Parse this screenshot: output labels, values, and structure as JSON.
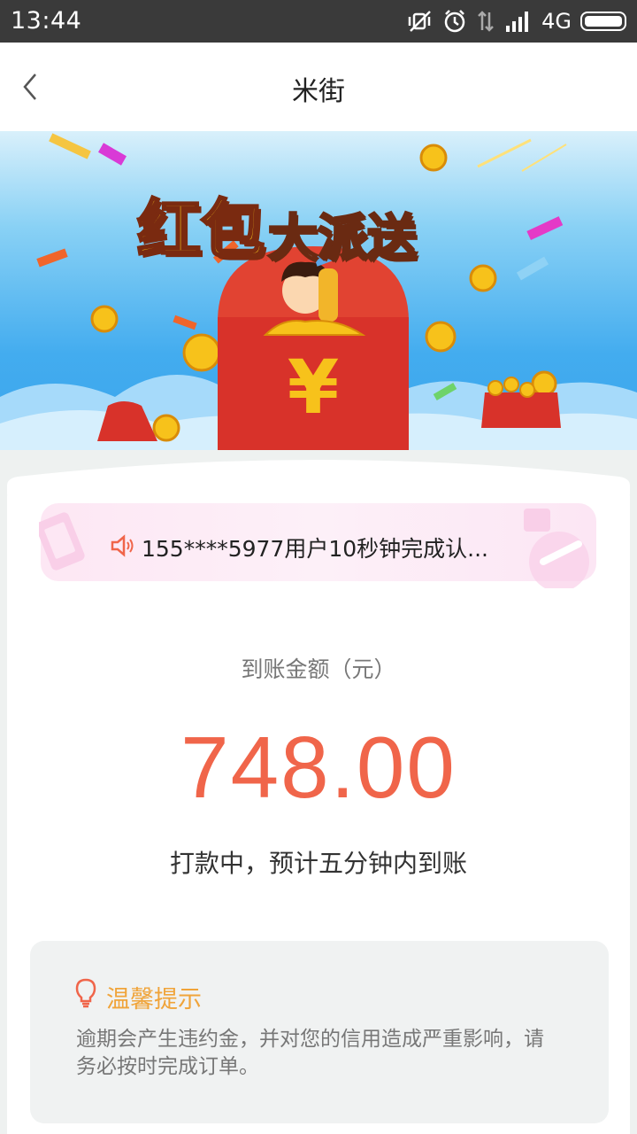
{
  "status_bar": {
    "time": "13:44",
    "network": "4G",
    "icons": [
      "mute-vibrate-icon",
      "alarm-icon",
      "data-arrows-icon",
      "signal-icon",
      "battery-icon"
    ]
  },
  "nav": {
    "title": "米街",
    "back_icon": "chevron-left-icon"
  },
  "banner": {
    "title_big": "红包",
    "title_small": "大派送",
    "symbol": "¥"
  },
  "ticker": {
    "icon": "speaker-icon",
    "text": "155****5977用户10秒钟完成认..."
  },
  "amount": {
    "label": "到账金额（元）",
    "value": "748.00",
    "status": "打款中，预计五分钟内到账"
  },
  "tip": {
    "icon": "lightbulb-icon",
    "title": "温馨提示",
    "body": "逾期会产生违约金，并对您的信用造成严重影响，请务必按时完成订单。"
  },
  "colors": {
    "accent": "#f0654a",
    "tip_title": "#f0a43a",
    "banner_sky": "#3aa5ec",
    "envelope_red": "#d8322a"
  }
}
